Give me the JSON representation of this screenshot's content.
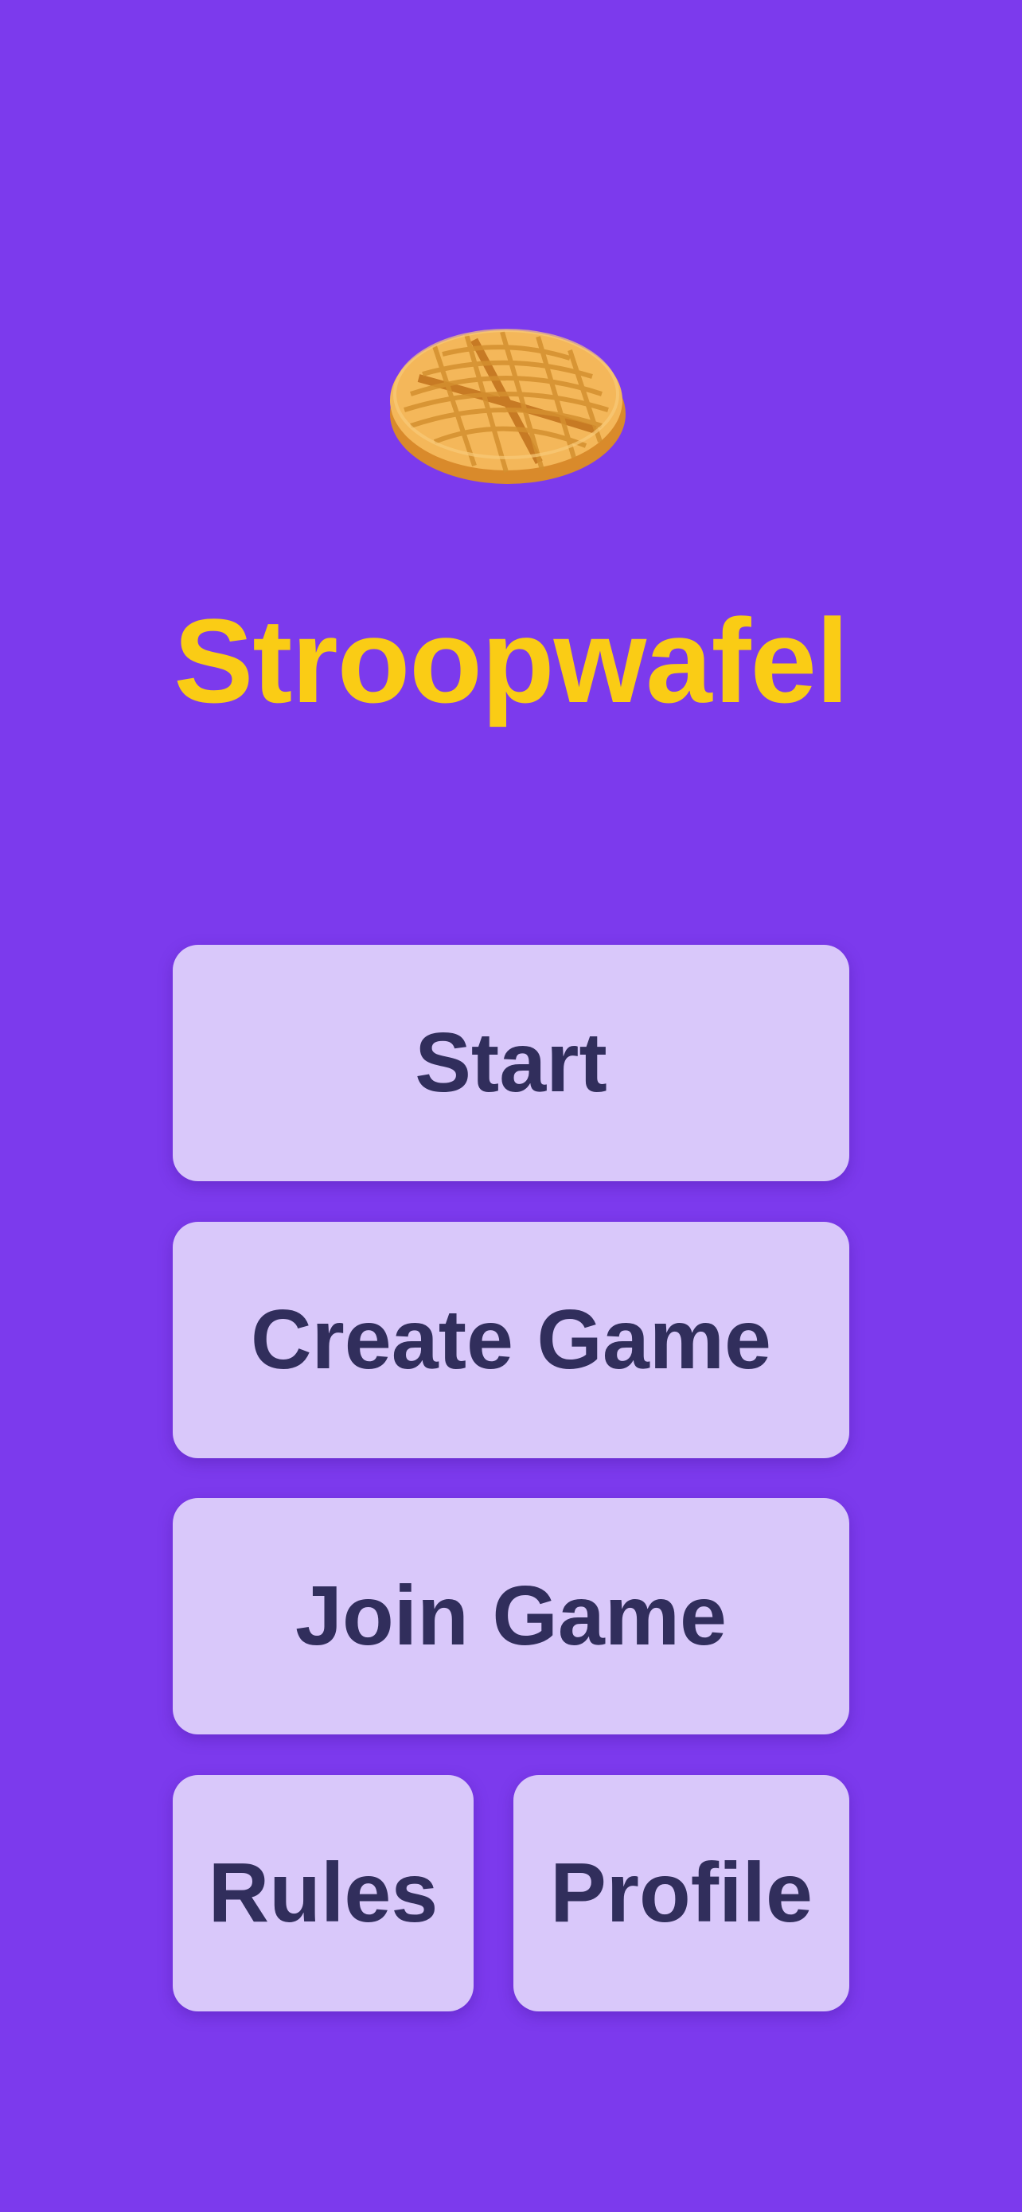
{
  "app": {
    "title": "Stroopwafel",
    "logo_icon": "waffle-icon"
  },
  "menu": {
    "start_label": "Start",
    "create_game_label": "Create Game",
    "join_game_label": "Join Game",
    "rules_label": "Rules",
    "profile_label": "Profile"
  },
  "colors": {
    "background": "#7c3aed",
    "title": "#facc15",
    "button_bg": "#d9c8fa",
    "button_text": "#312e5c"
  }
}
